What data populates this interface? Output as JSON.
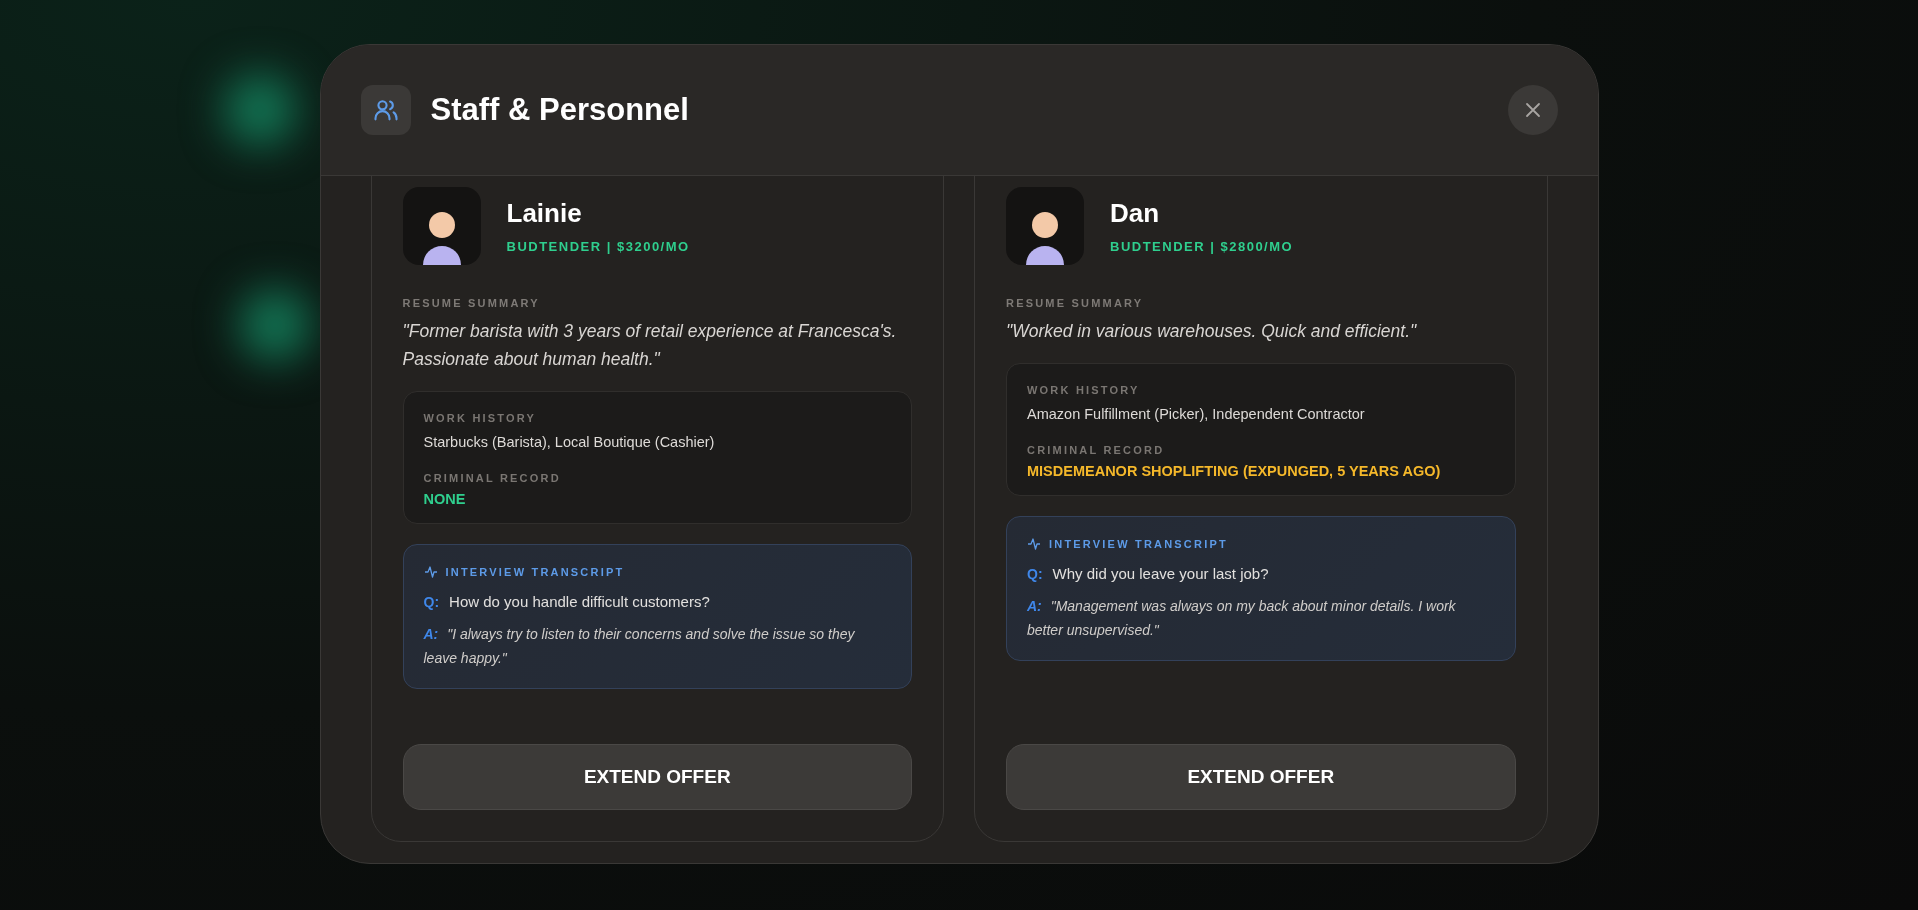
{
  "modal": {
    "title": "Staff & Personnel"
  },
  "candidates": [
    {
      "name": "Lainie",
      "role": "BUDTENDER | $3200/MO",
      "resume_label": "RESUME SUMMARY",
      "summary": "\"Former barista with 3 years of retail experience at Francesca's. Passionate about human health.\"",
      "work_history_label": "WORK HISTORY",
      "work_history": "Starbucks (Barista), Local Boutique (Cashier)",
      "criminal_record": {
        "label": "CRIMINAL RECORD",
        "text": "NONE",
        "color": "#2fcf8e"
      },
      "transcript_label": "INTERVIEW TRANSCRIPT",
      "q_label": "Q:",
      "question": "How do you handle difficult customers?",
      "a_label": "A:",
      "answer": "\"I always try to listen to their concerns and solve the issue so they leave happy.\"",
      "button": "EXTEND OFFER"
    },
    {
      "name": "Dan",
      "role": "BUDTENDER | $2800/MO",
      "resume_label": "RESUME SUMMARY",
      "summary": "\"Worked in various warehouses. Quick and efficient.\"",
      "work_history_label": "WORK HISTORY",
      "work_history": "Amazon Fulfillment (Picker), Independent Contractor",
      "criminal_record": {
        "label": "CRIMINAL RECORD",
        "text": "MISDEMEANOR SHOPLIFTING (EXPUNGED, 5 YEARS AGO)",
        "color": "#f5b82a"
      },
      "transcript_label": "INTERVIEW TRANSCRIPT",
      "q_label": "Q:",
      "question": "Why did you leave your last job?",
      "a_label": "A:",
      "answer": "\"Management was always on my back about minor details. I work better unsupervised.\"",
      "button": "EXTEND OFFER"
    }
  ]
}
